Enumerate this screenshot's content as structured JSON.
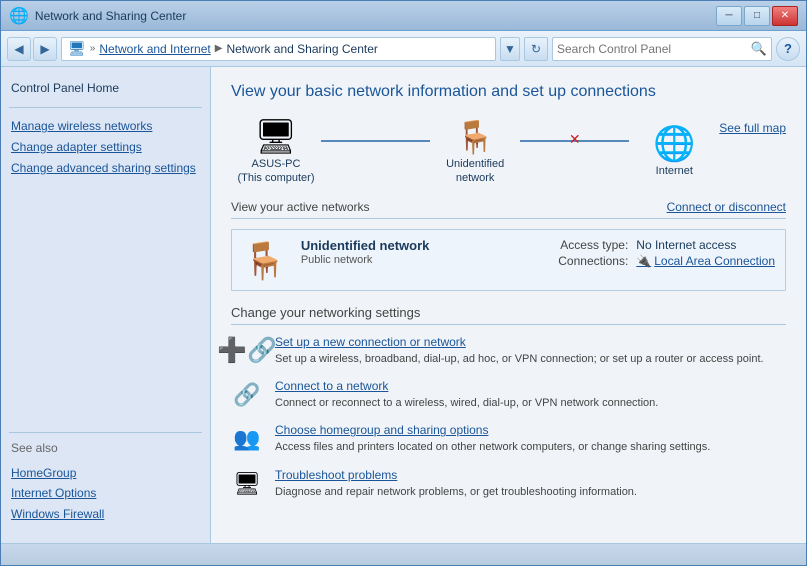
{
  "window": {
    "title": "Network and Sharing Center",
    "controls": {
      "minimize": "─",
      "maximize": "□",
      "close": "✕"
    }
  },
  "addressbar": {
    "back_label": "◀",
    "forward_label": "▶",
    "breadcrumb": {
      "icon": "🖥",
      "parts": [
        "Network and Internet",
        "Network and Sharing Center"
      ]
    },
    "arrow_label": "▼",
    "refresh_label": "↻",
    "search_placeholder": "Search Control Panel",
    "search_icon": "🔍",
    "help_label": "?"
  },
  "sidebar": {
    "home_label": "Control Panel Home",
    "links": [
      "Manage wireless networks",
      "Change adapter settings",
      "Change advanced sharing settings"
    ],
    "see_also_label": "See also",
    "see_also_links": [
      "HomeGroup",
      "Internet Options",
      "Windows Firewall"
    ]
  },
  "content": {
    "title": "View your basic network information and set up connections",
    "see_full_map": "See full map",
    "network_nodes": [
      {
        "label": "ASUS-PC\n(This computer)"
      },
      {
        "label": "Unidentified network"
      },
      {
        "label": "Internet"
      }
    ],
    "active_networks_label": "View your active networks",
    "connect_or_disconnect": "Connect or disconnect",
    "active_network": {
      "name": "Unidentified network",
      "type": "Public network",
      "access_type_key": "Access type:",
      "access_type_val": "No Internet access",
      "connections_key": "Connections:",
      "connections_val": "Local Area Connection"
    },
    "change_settings_label": "Change your networking settings",
    "settings": [
      {
        "link": "Set up a new connection or network",
        "desc": "Set up a wireless, broadband, dial-up, ad hoc, or VPN connection; or set up a router or access point."
      },
      {
        "link": "Connect to a network",
        "desc": "Connect or reconnect to a wireless, wired, dial-up, or VPN network connection."
      },
      {
        "link": "Choose homegroup and sharing options",
        "desc": "Access files and printers located on other network computers, or change sharing settings."
      },
      {
        "link": "Troubleshoot problems",
        "desc": "Diagnose and repair network problems, or get troubleshooting information."
      }
    ]
  }
}
